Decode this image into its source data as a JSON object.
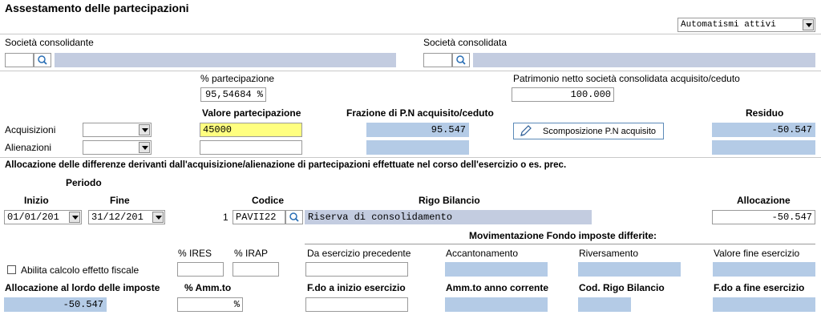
{
  "header": {
    "title": "Assestamento delle partecipazioni",
    "automation_select": "Automatismi attivi"
  },
  "consolidante": {
    "label": "Società consolidante",
    "code": "",
    "name": ""
  },
  "consolidata": {
    "label": "Società consolidata",
    "code": "",
    "name": ""
  },
  "partecipazione": {
    "percent_label": "% partecipazione",
    "percent_value": "95,54684 %",
    "pn_label": "Patrimonio netto società consolidata acquisito/ceduto",
    "pn_value": "100.000"
  },
  "columns": {
    "valore": "Valore partecipazione",
    "frazione": "Frazione di P.N acquisito/ceduto",
    "residuo": "Residuo"
  },
  "acquisizioni": {
    "label": "Acquisizioni",
    "type": "",
    "valore": "45000",
    "frazione": "95.547",
    "scomposizione_button": "Scomposizione P.N acquisito",
    "residuo": "-50.547"
  },
  "alienazioni": {
    "label": "Alienazioni",
    "type": "",
    "valore": "",
    "frazione": "",
    "residuo": ""
  },
  "allocazione": {
    "section_title": "Allocazione delle differenze derivanti dall'acquisizione/alienazione di partecipazioni effettuate nel corso dell'esercizio o es. prec.",
    "periodo_label": "Periodo",
    "inizio_label": "Inizio",
    "fine_label": "Fine",
    "codice_label": "Codice",
    "rigo_label": "Rigo Bilancio",
    "allocazione_label": "Allocazione",
    "inizio": "01/01/201",
    "fine": "31/12/201",
    "row_number": "1",
    "codice": "PAVII22",
    "rigo": "Riserva di consolidamento",
    "allocazione": "-50.547"
  },
  "fondo": {
    "title": "Movimentazione Fondo imposte differite:",
    "ires_label": "% IRES",
    "irap_label": "% IRAP",
    "da_esercizio_label": "Da esercizio precedente",
    "accantonamento_label": "Accantonamento",
    "riversamento_label": "Riversamento",
    "valore_fine_label": "Valore fine esercizio",
    "checkbox_label": "Abilita calcolo effetto fiscale",
    "lordo_label": "Allocazione al lordo delle imposte",
    "amm_label": "% Amm.to",
    "fdo_inizio_label": "F.do a inizio esercizio",
    "amm_anno_label": "Amm.to anno corrente",
    "cod_rigo_label": "Cod. Rigo Bilancio",
    "fdo_fine_label": "F.do a fine esercizio",
    "lordo_value": "-50.547",
    "amm_unit": "%"
  }
}
